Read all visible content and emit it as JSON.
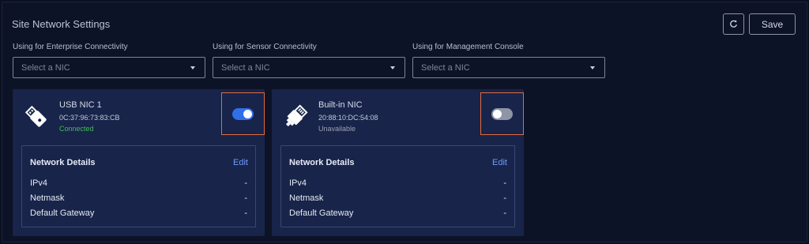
{
  "page": {
    "title": "Site Network Settings"
  },
  "toolbar": {
    "refresh_icon": "refresh-icon",
    "save_label": "Save"
  },
  "selectors": [
    {
      "label": "Using for Enterprise Connectivity",
      "placeholder": "Select a NIC"
    },
    {
      "label": "Using for Sensor Connectivity",
      "placeholder": "Select a NIC"
    },
    {
      "label": "Using for Management Console",
      "placeholder": "Select a NIC"
    }
  ],
  "nics": [
    {
      "name": "USB NIC 1",
      "mac": "0C:37:96:73:83:CB",
      "status": "Connected",
      "status_color": "#3fbf5a",
      "icon": "usb-icon",
      "enabled": true,
      "toggle_color": "#2f6fe8",
      "details": {
        "title": "Network Details",
        "edit": "Edit",
        "rows": [
          {
            "label": "IPv4",
            "value": "-"
          },
          {
            "label": "Netmask",
            "value": "-"
          },
          {
            "label": "Default Gateway",
            "value": "-"
          }
        ]
      }
    },
    {
      "name": "Built-in NIC",
      "mac": "20:88:10:DC:54:08",
      "status": "Unavailable",
      "status_color": "#9aa2b4",
      "icon": "ethernet-plug-icon",
      "enabled": false,
      "toggle_color": "#8d95a6",
      "details": {
        "title": "Network Details",
        "edit": "Edit",
        "rows": [
          {
            "label": "IPv4",
            "value": "-"
          },
          {
            "label": "Netmask",
            "value": "-"
          },
          {
            "label": "Default Gateway",
            "value": "-"
          }
        ]
      }
    }
  ]
}
